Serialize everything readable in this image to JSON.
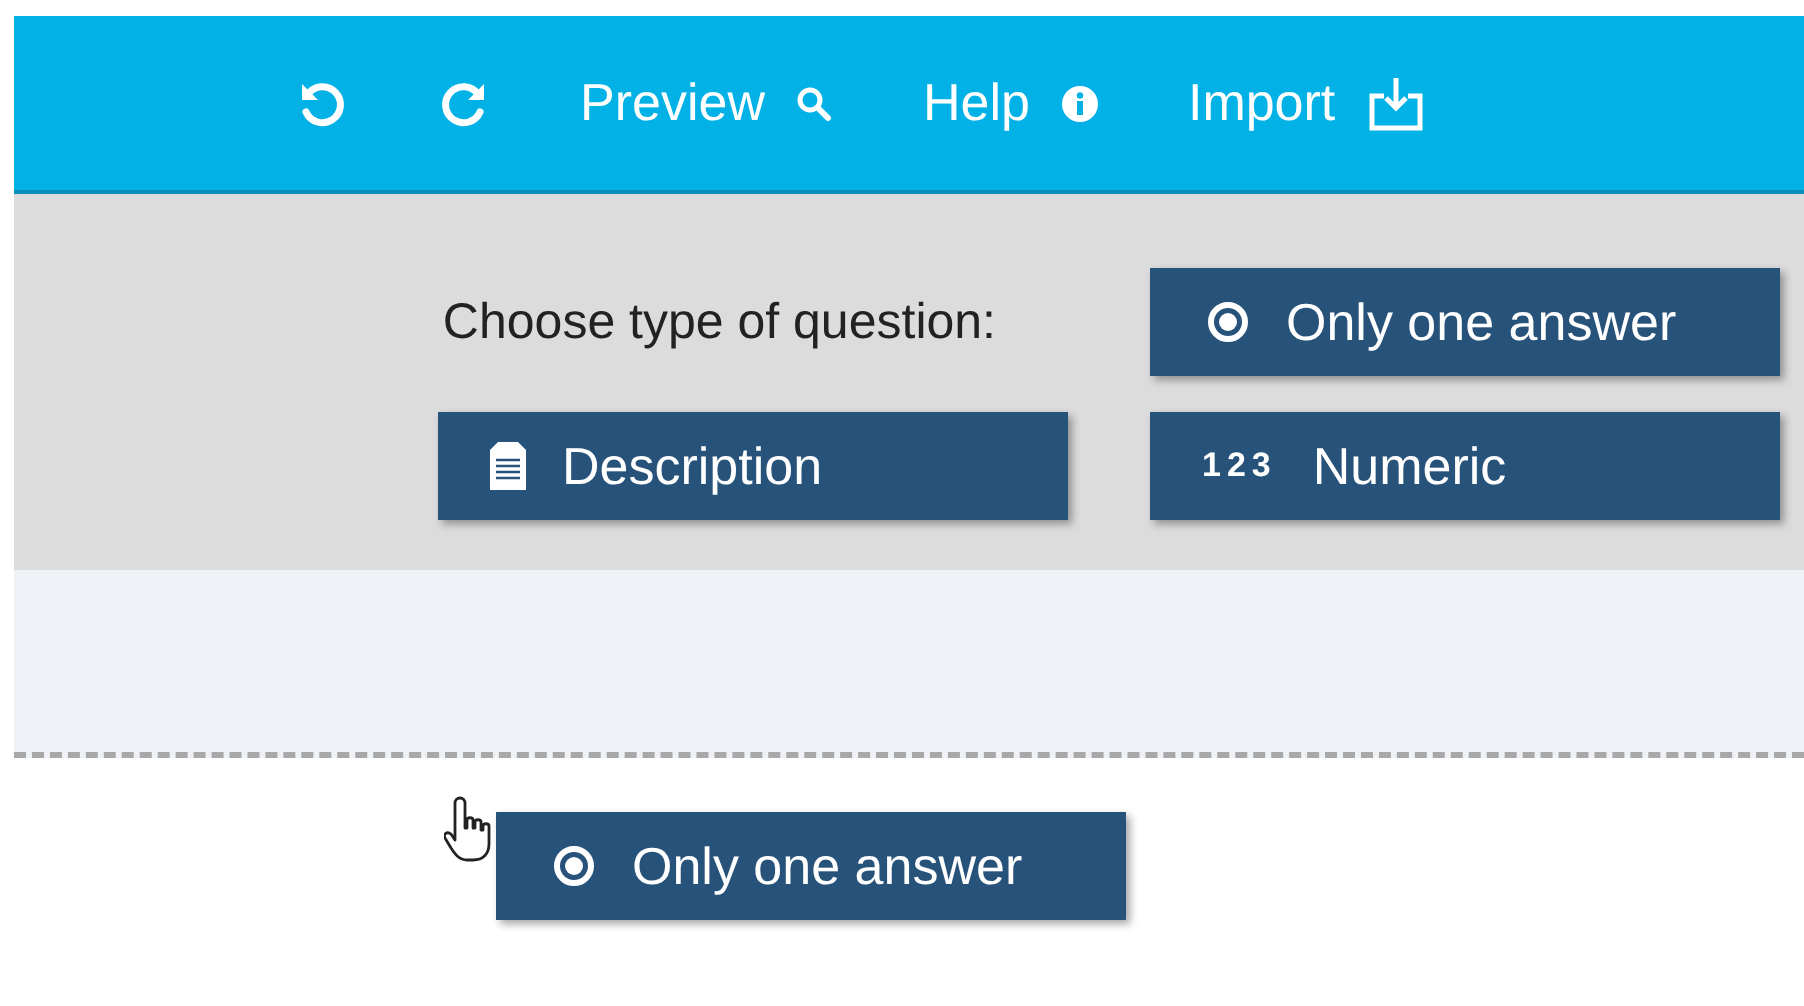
{
  "toolbar": {
    "items": [
      {
        "kind": "undo"
      },
      {
        "kind": "redo"
      },
      {
        "kind": "preview",
        "label": "Preview"
      },
      {
        "kind": "help",
        "label": "Help"
      },
      {
        "kind": "import",
        "label": "Import"
      }
    ]
  },
  "question_panel": {
    "label": "Choose type of question:",
    "types": [
      {
        "kind": "single",
        "label": "Only one answer"
      },
      {
        "kind": "description",
        "label": "Description"
      },
      {
        "kind": "numeric",
        "label": "Numeric",
        "icon_text": "123"
      }
    ]
  },
  "dragged_item": {
    "kind": "single",
    "label": "Only one answer"
  }
}
